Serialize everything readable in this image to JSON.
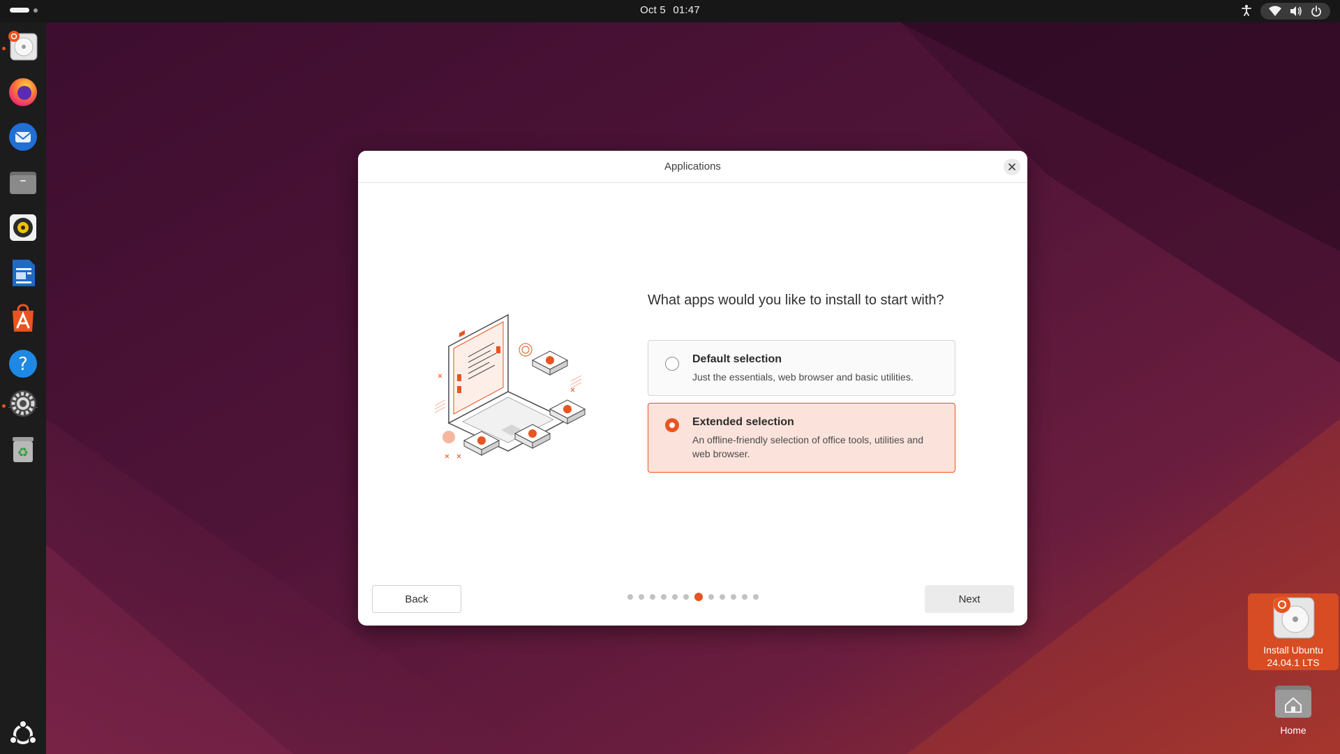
{
  "topbar": {
    "date": "Oct 5",
    "time": "01:47",
    "icons": [
      "activities-indicator",
      "accessibility-icon",
      "wifi-icon",
      "volume-icon",
      "power-icon"
    ]
  },
  "dock": {
    "apps": [
      {
        "name": "install-ubuntu",
        "icon": "installer-icon",
        "running": true
      },
      {
        "name": "firefox",
        "icon": "firefox-icon",
        "running": false
      },
      {
        "name": "thunderbird",
        "icon": "thunderbird-icon",
        "running": false
      },
      {
        "name": "files",
        "icon": "files-icon",
        "running": false
      },
      {
        "name": "rhythmbox",
        "icon": "rhythmbox-icon",
        "running": false
      },
      {
        "name": "libreoffice-writer",
        "icon": "writer-icon",
        "running": false
      },
      {
        "name": "app-center",
        "icon": "app-center-icon",
        "running": false
      },
      {
        "name": "help",
        "icon": "help-icon",
        "running": false
      },
      {
        "name": "settings",
        "icon": "settings-icon",
        "running": true
      },
      {
        "name": "trash",
        "icon": "trash-icon",
        "running": false
      }
    ],
    "show_apps_icon": "ubuntu-logo-icon"
  },
  "dialog": {
    "title": "Applications",
    "question": "What apps would you like to install to start with?",
    "options": [
      {
        "title": "Default selection",
        "description": "Just the essentials, web browser and basic utilities.",
        "selected": false
      },
      {
        "title": "Extended selection",
        "description": "An offline-friendly selection of office tools, utilities and web browser.",
        "selected": true
      }
    ],
    "back_label": "Back",
    "next_label": "Next",
    "pager": {
      "total": 12,
      "current": 7
    }
  },
  "desktop": {
    "install_label": "Install Ubuntu 24.04.1 LTS",
    "home_label": "Home"
  },
  "colors": {
    "accent": "#e95420",
    "selected_bg": "#fbe3db",
    "topbar": "#171717",
    "dock": "#1c1c1c"
  }
}
